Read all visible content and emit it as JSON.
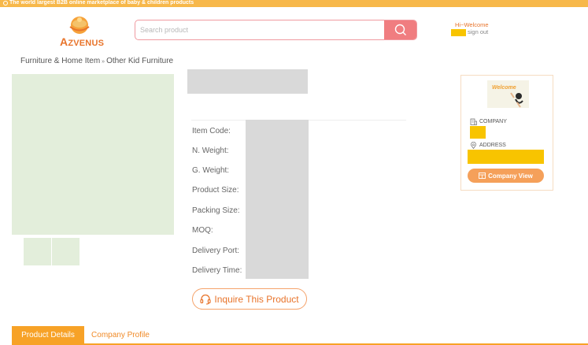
{
  "topbar": {
    "tagline": "The world largest B2B online marketplace of baby & children products"
  },
  "brand": {
    "logo_text_first": "A",
    "logo_text_rest": "ZVENUS"
  },
  "search": {
    "placeholder": "Search product",
    "button_icon": "search-icon"
  },
  "account": {
    "welcome": "Hi~Welcome",
    "sign_out": "sign out"
  },
  "breadcrumb": {
    "parent": "Furniture & Home Item",
    "separator": "»",
    "current": "Other Kid Furniture"
  },
  "product": {
    "spec_labels": [
      "Item Code:",
      "N. Weight:",
      "G. Weight:",
      "Product Size:",
      "Packing Size:",
      "MOQ:",
      "Delivery Port:",
      "Delivery Time:"
    ],
    "inquire_label": "Inquire This Product",
    "inquire_icon": "headset-icon"
  },
  "company_card": {
    "banner_text": "Welcome",
    "company_label": "COMPANY",
    "address_label": "ADDRESS",
    "view_button": "Company View"
  },
  "tabs": [
    {
      "label": "Product Details",
      "active": true
    },
    {
      "label": "Company Profile",
      "active": false
    }
  ],
  "colors": {
    "accent_orange": "#f7a227",
    "search_button": "#f07d80",
    "redacted_yellow": "#f8c400",
    "image_placeholder": "#e3eedb",
    "text_placeholder": "#d9d9d9"
  }
}
